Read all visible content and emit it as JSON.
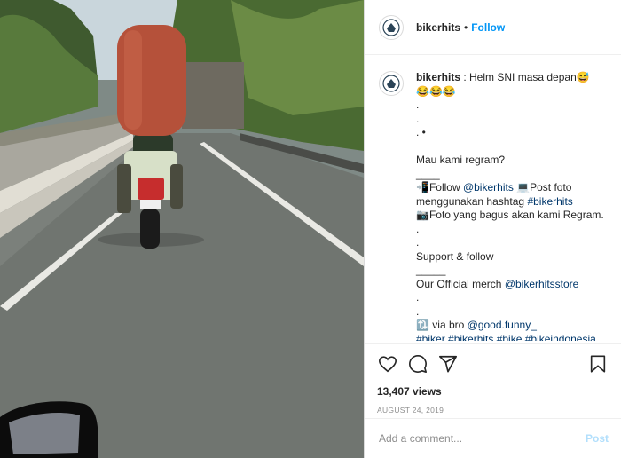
{
  "post": {
    "username": "bikerhits",
    "follow_label": "Follow",
    "dot": "•"
  },
  "caption": {
    "username": "bikerhits",
    "lines": [
      " : Helm SNI masa depan😅",
      "😂😂😂",
      ".",
      ".",
      ". •",
      "Mau kami regram?",
      "____",
      "📲Follow ",
      "@bikerhits",
      " 💻Post foto menggunakan hashtag ",
      "#bikerhits",
      "\n📷Foto yang bagus akan kami Regram.",
      ".",
      ".",
      "Support & follow",
      "_____",
      "Our Official merch ",
      "@bikerhitsstore",
      ".",
      ".",
      "🔃 via bro ",
      "@good.funny_",
      "#biker #bikerhits #bike #bikeindonesia"
    ]
  },
  "stats": {
    "views": "13,407 views",
    "date": "AUGUST 24, 2019"
  },
  "comment": {
    "placeholder": "Add a comment...",
    "post_label": "Post"
  },
  "icons": {
    "like": "heart-icon",
    "comment": "comment-icon",
    "share": "share-icon",
    "save": "bookmark-icon"
  },
  "colors": {
    "accent": "#0095f6",
    "post_disabled": "#b2dffc",
    "muted": "#8e8e8e"
  }
}
